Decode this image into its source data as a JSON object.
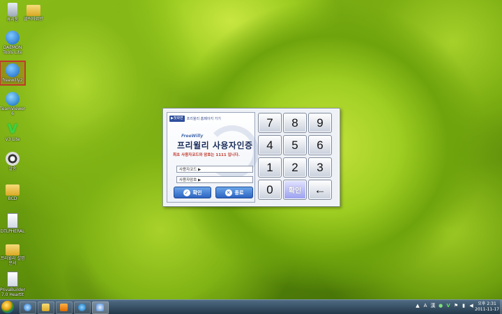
{
  "desktop": {
    "icons": [
      {
        "label": "휴지통",
        "icon": "recycle-bin-icon"
      },
      {
        "label": "클릭자료방",
        "icon": "folder-icon"
      },
      {
        "label": "DAEMON Tools Lite",
        "icon": "daemon-tools-icon"
      },
      {
        "label": "freewilly2",
        "icon": "freewilly-icon"
      },
      {
        "label": "TeamViewer 6",
        "icon": "teamviewer-icon"
      },
      {
        "label": "V3 Lite",
        "icon": "v3-icon"
      },
      {
        "label": "알송",
        "icon": "alsong-icon"
      },
      {
        "label": "BCD",
        "icon": "folder-icon"
      },
      {
        "label": "DTLPHERAL",
        "icon": "document-icon"
      },
      {
        "label": "프리윌리 설명 문서",
        "icon": "folder-icon"
      },
      {
        "label": "PrivaBuilder 7.0 Heartlt",
        "icon": "privabuilder-icon"
      }
    ]
  },
  "dialog": {
    "home_button": "▶첫화면",
    "home_link": "프리윌리 홈페이지 가기",
    "brand_small": "FreeWilly",
    "title": "프리윌리 사용자인증",
    "notice": "최초 사용자코드와 암호는 1111 입니다.",
    "user_code_label": "사용자코드 ▶",
    "password_label": "사용자암호 ▶",
    "user_code_value": "",
    "password_value": "",
    "confirm_button": "확인",
    "exit_button": "종료",
    "keypad": [
      "7",
      "8",
      "9",
      "4",
      "5",
      "6",
      "1",
      "2",
      "3",
      "0",
      "확인",
      "←"
    ]
  },
  "taskbar": {
    "tray_ime": "A",
    "tray_hanja": "漢",
    "clock_period": "오후 2:31",
    "clock_date": "2011-11-17"
  },
  "colors": {
    "accent_blue": "#2c64c2",
    "notice_red": "#c0392b",
    "title_navy": "#1a2c5a"
  }
}
